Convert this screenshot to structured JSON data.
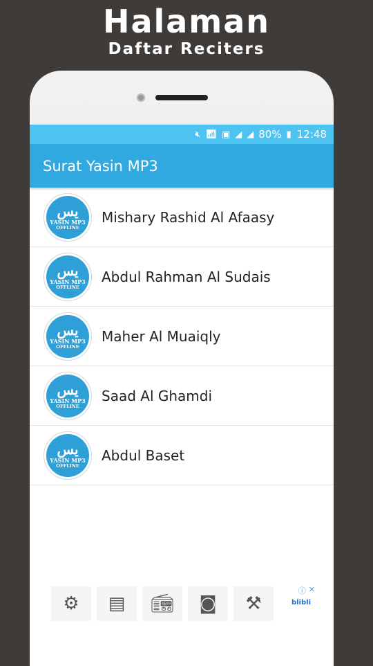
{
  "promo": {
    "title": "Halaman",
    "subtitle": "Daftar Reciters"
  },
  "statusbar": {
    "icons": [
      "mute-icon",
      "wifi-icon",
      "sim-icon",
      "signal-icon",
      "signal-icon"
    ],
    "battery": "80%",
    "time": "12:48"
  },
  "appbar": {
    "title": "Surat Yasin MP3"
  },
  "logo": {
    "arabic": "يس",
    "line1": "YASIN MP3",
    "line2": "OFFLINE"
  },
  "reciters": [
    {
      "name": "Mishary Rashid Al Afaasy"
    },
    {
      "name": "Abdul Rahman Al Sudais"
    },
    {
      "name": "Maher Al Muaiqly"
    },
    {
      "name": "Saad Al Ghamdi"
    },
    {
      "name": "Abdul Baset"
    }
  ],
  "ad": {
    "items": [
      "product-image-1",
      "product-image-2",
      "product-image-3",
      "product-image-4",
      "product-image-5"
    ],
    "choices_icon": "ⓘ",
    "close_icon": "✕",
    "brand": "blibli"
  },
  "colors": {
    "statusbar": "#4cc3f1",
    "appbar": "#2fa9e0",
    "logo": "#2f9fd8",
    "background": "#3f3b39"
  }
}
